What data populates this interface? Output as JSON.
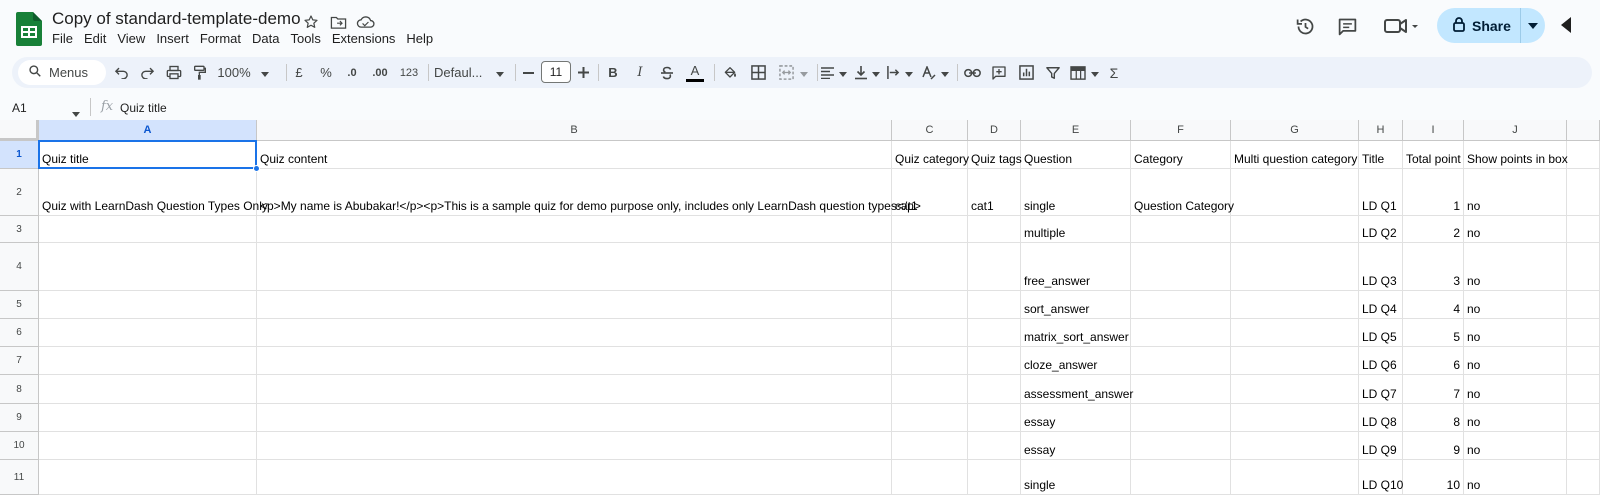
{
  "document": {
    "title": "Copy of standard-template-demo"
  },
  "menu": [
    "File",
    "Edit",
    "View",
    "Insert",
    "Format",
    "Data",
    "Tools",
    "Extensions",
    "Help"
  ],
  "header": {
    "share_label": "Share"
  },
  "toolbar": {
    "search_label": "Menus",
    "zoom": "100%",
    "currency": "£",
    "percent": "%",
    "decrease_decimal": ".0",
    "increase_decimal": ".00",
    "number_format": "123",
    "font": "Defaul...",
    "font_size": "11",
    "bold": "B",
    "italic": "I",
    "text_color": "A",
    "sum": "Σ"
  },
  "formula_bar": {
    "name_box": "A1",
    "fx": "fx",
    "content": "Quiz title"
  },
  "columns": [
    "A",
    "B",
    "C",
    "D",
    "E",
    "F",
    "G",
    "H",
    "I",
    "J"
  ],
  "rows": [
    {
      "num": "1",
      "cells": [
        "Quiz title",
        "Quiz content",
        "Quiz category",
        "Quiz tags",
        "Question",
        "Category",
        "Multi question category",
        "Title",
        "Total point",
        "Show points in box"
      ]
    },
    {
      "num": "2",
      "cells": [
        "Quiz with LearnDash Question Types Only",
        "<p>My name is Abubakar!</p><p>This is a sample quiz for demo purpose only, includes only LearnDash question types</p>",
        "cat1",
        "cat1",
        "single",
        "Question Category",
        "",
        "LD Q1",
        "1",
        "no"
      ]
    },
    {
      "num": "3",
      "cells": [
        "",
        "",
        "",
        "",
        "multiple",
        "",
        "",
        "LD Q2",
        "2",
        "no"
      ]
    },
    {
      "num": "4",
      "cells": [
        "",
        "",
        "",
        "",
        "free_answer",
        "",
        "",
        "LD Q3",
        "3",
        "no"
      ]
    },
    {
      "num": "5",
      "cells": [
        "",
        "",
        "",
        "",
        "sort_answer",
        "",
        "",
        "LD Q4",
        "4",
        "no"
      ]
    },
    {
      "num": "6",
      "cells": [
        "",
        "",
        "",
        "",
        "matrix_sort_answer",
        "",
        "",
        "LD Q5",
        "5",
        "no"
      ]
    },
    {
      "num": "7",
      "cells": [
        "",
        "",
        "",
        "",
        "cloze_answer",
        "",
        "",
        "LD Q6",
        "6",
        "no"
      ]
    },
    {
      "num": "8",
      "cells": [
        "",
        "",
        "",
        "",
        "assessment_answer",
        "",
        "",
        "LD Q7",
        "7",
        "no"
      ]
    },
    {
      "num": "9",
      "cells": [
        "",
        "",
        "",
        "",
        "essay",
        "",
        "",
        "LD Q8",
        "8",
        "no"
      ]
    },
    {
      "num": "10",
      "cells": [
        "",
        "",
        "",
        "",
        "essay",
        "",
        "",
        "LD Q9",
        "9",
        "no"
      ]
    },
    {
      "num": "11",
      "cells": [
        "",
        "",
        "",
        "",
        "single",
        "",
        "",
        "LD Q10",
        "10",
        "no"
      ]
    }
  ],
  "colors": {
    "accent": "#1a73e8",
    "share_bg": "#c2e7ff",
    "sheets_green": "#188038"
  },
  "icons": [
    "sheets-logo",
    "star-icon",
    "move-folder-icon",
    "cloud-status-icon",
    "history-icon",
    "comment-icon",
    "meet-icon",
    "lock-icon",
    "search-icon",
    "undo-icon",
    "redo-icon",
    "print-icon",
    "paint-format-icon",
    "fill-color-icon",
    "borders-icon",
    "merge-cells-icon",
    "align-icon",
    "vertical-align-icon",
    "text-wrap-icon",
    "text-rotate-icon",
    "link-icon",
    "insert-comment-icon",
    "chart-icon",
    "filter-icon",
    "filter-views-icon"
  ]
}
